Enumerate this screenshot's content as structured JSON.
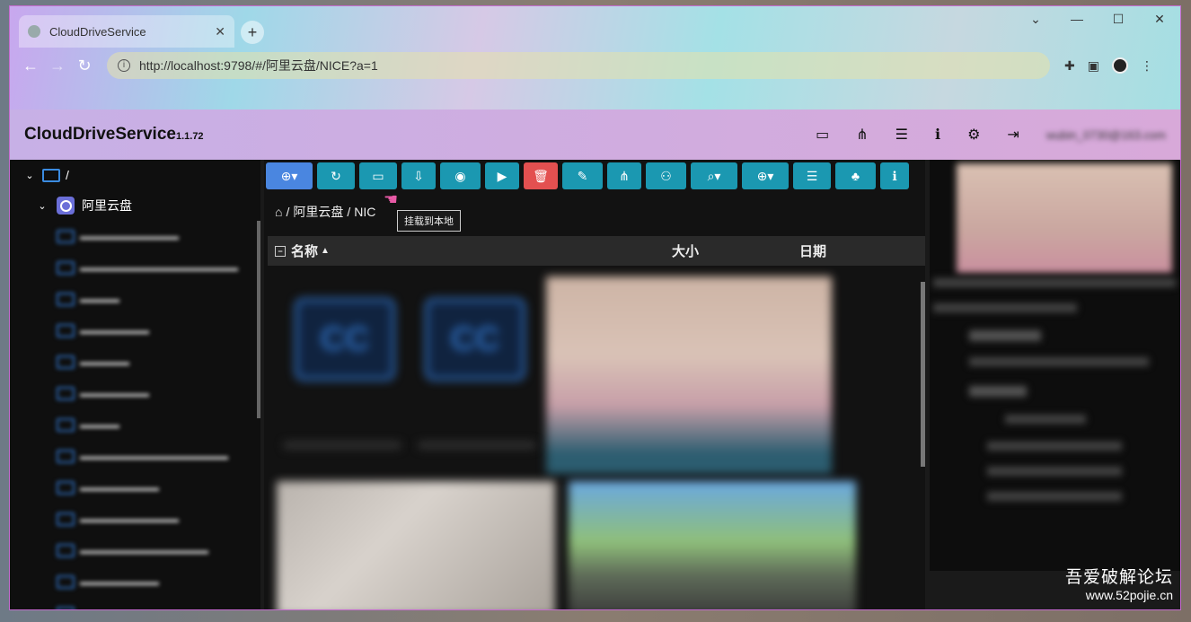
{
  "browser": {
    "tab_title": "CloudDriveService",
    "new_tab": "+",
    "close_tab": "✕",
    "url": "http://localhost:9798/#/阿里云盘/NICE?a=1",
    "window_controls": [
      "⌄",
      "—",
      "☐",
      "✕"
    ]
  },
  "app": {
    "brand": "CloudDriveService",
    "version": "1.1.72",
    "user": "wubin_0730@163.com"
  },
  "tree": {
    "root": "/",
    "drive": "阿里云盘"
  },
  "toolbar": {
    "tooltip": "挂载到本地"
  },
  "breadcrumb": {
    "home": "⌂",
    "sep": "/",
    "drive": "阿里云盘",
    "current": "NIC"
  },
  "columns": {
    "name": "名称",
    "sort": "▲",
    "size": "大小",
    "date": "日期"
  },
  "watermark": {
    "cn": "吾爱破解论坛",
    "url": "www.52pojie.cn"
  }
}
